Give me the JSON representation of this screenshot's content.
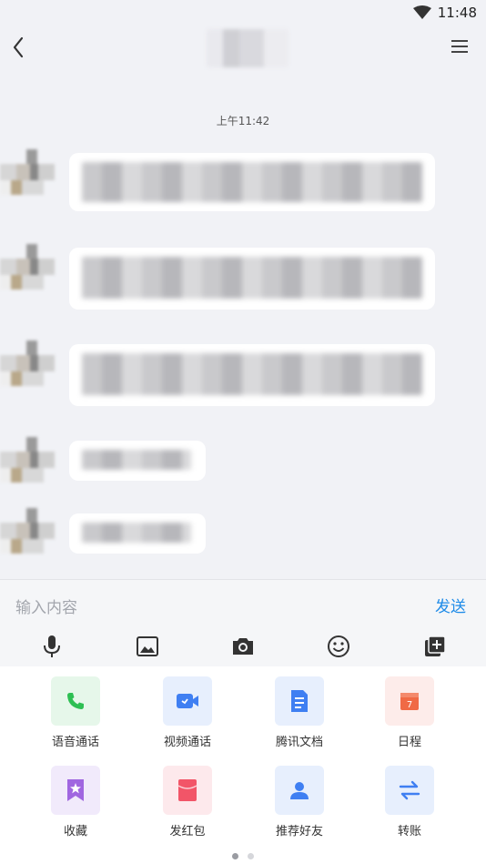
{
  "status_bar": {
    "time": "11:48"
  },
  "chat": {
    "timestamp": "上午11:42"
  },
  "input": {
    "placeholder": "输入内容",
    "send_label": "发送"
  },
  "toolbar_icons": [
    "microphone-icon",
    "image-icon",
    "camera-icon",
    "emoji-icon",
    "add-icon"
  ],
  "panel": {
    "items": [
      {
        "label": "语音通话",
        "icon": "phone-icon",
        "bg": "#e6f7ea",
        "color": "#2ebf53"
      },
      {
        "label": "视频通话",
        "icon": "video-icon",
        "bg": "#e7effd",
        "color": "#3f7ff2"
      },
      {
        "label": "腾讯文档",
        "icon": "document-icon",
        "bg": "#e7effd",
        "color": "#3f7ff2"
      },
      {
        "label": "日程",
        "icon": "calendar-icon",
        "bg": "#fdecea",
        "color": "#f06a45"
      },
      {
        "label": "收藏",
        "icon": "bookmark-star-icon",
        "bg": "#f1eafb",
        "color": "#a066e0"
      },
      {
        "label": "发红包",
        "icon": "red-envelope-icon",
        "bg": "#fde9ec",
        "color": "#f25568"
      },
      {
        "label": "推荐好友",
        "icon": "user-icon",
        "bg": "#e7effd",
        "color": "#3f7ff2"
      },
      {
        "label": "转账",
        "icon": "transfer-icon",
        "bg": "#e7effd",
        "color": "#3f7ff2"
      }
    ],
    "page_indicator": {
      "current": 1,
      "total": 2
    }
  },
  "colors": {
    "accent": "#1e8be8",
    "background": "#f1f2f6"
  }
}
